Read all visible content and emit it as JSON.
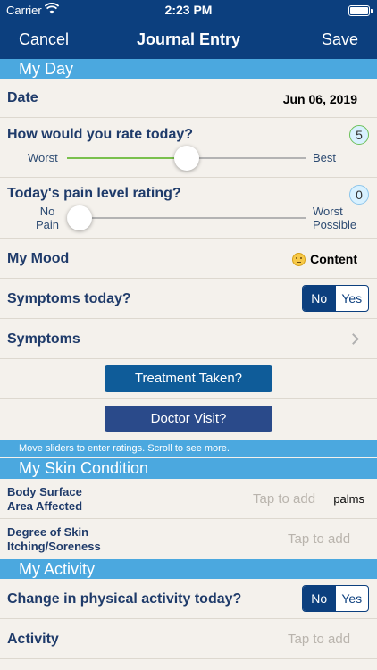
{
  "status_bar": {
    "carrier": "Carrier",
    "time": "2:23 PM",
    "wifi_icon": "wifi-icon",
    "battery_icon": "battery-icon"
  },
  "nav": {
    "cancel": "Cancel",
    "title": "Journal Entry",
    "save": "Save"
  },
  "my_day": {
    "header": "My Day",
    "date_label": "Date",
    "date_value": "Jun 06, 2019",
    "rate_label": "How would you rate today?",
    "rate_value": "5",
    "rate_fraction": 0.5,
    "rate_min": "Worst",
    "rate_max": "Best",
    "pain_label": "Today's pain level rating?",
    "pain_value": "0",
    "pain_fraction": 0.0,
    "pain_min_1": "No",
    "pain_min_2": "Pain",
    "pain_max_1": "Worst",
    "pain_max_2": "Possible",
    "mood_label": "My Mood",
    "mood_value": "Content",
    "mood_icon": "slightly-smiling-face-icon",
    "symptoms_today_label": "Symptoms today?",
    "symptoms_today_options": [
      "No",
      "Yes"
    ],
    "symptoms_today_selected": "No",
    "symptoms_label": "Symptoms",
    "treatment_button": "Treatment Taken?",
    "doctor_button": "Doctor Visit?"
  },
  "hint": "Move sliders to enter ratings. Scroll to see more.",
  "skin": {
    "header": "My Skin Condition",
    "surface_label_1": "Body Surface",
    "surface_label_2": "Area Affected",
    "surface_placeholder": "Tap to add",
    "surface_value": "palms",
    "itch_label_1": "Degree of Skin",
    "itch_label_2": "Itching/Soreness",
    "itch_placeholder": "Tap to add"
  },
  "activity": {
    "header": "My Activity",
    "change_label": "Change in physical activity today?",
    "change_options": [
      "No",
      "Yes"
    ],
    "change_selected": "No",
    "activity_label": "Activity",
    "activity_placeholder": "Tap to add"
  },
  "colors": {
    "nav": "#0c3f7e",
    "section": "#4ba8df",
    "background": "#f4f1ec",
    "slider_fill": "#7ac04d"
  }
}
